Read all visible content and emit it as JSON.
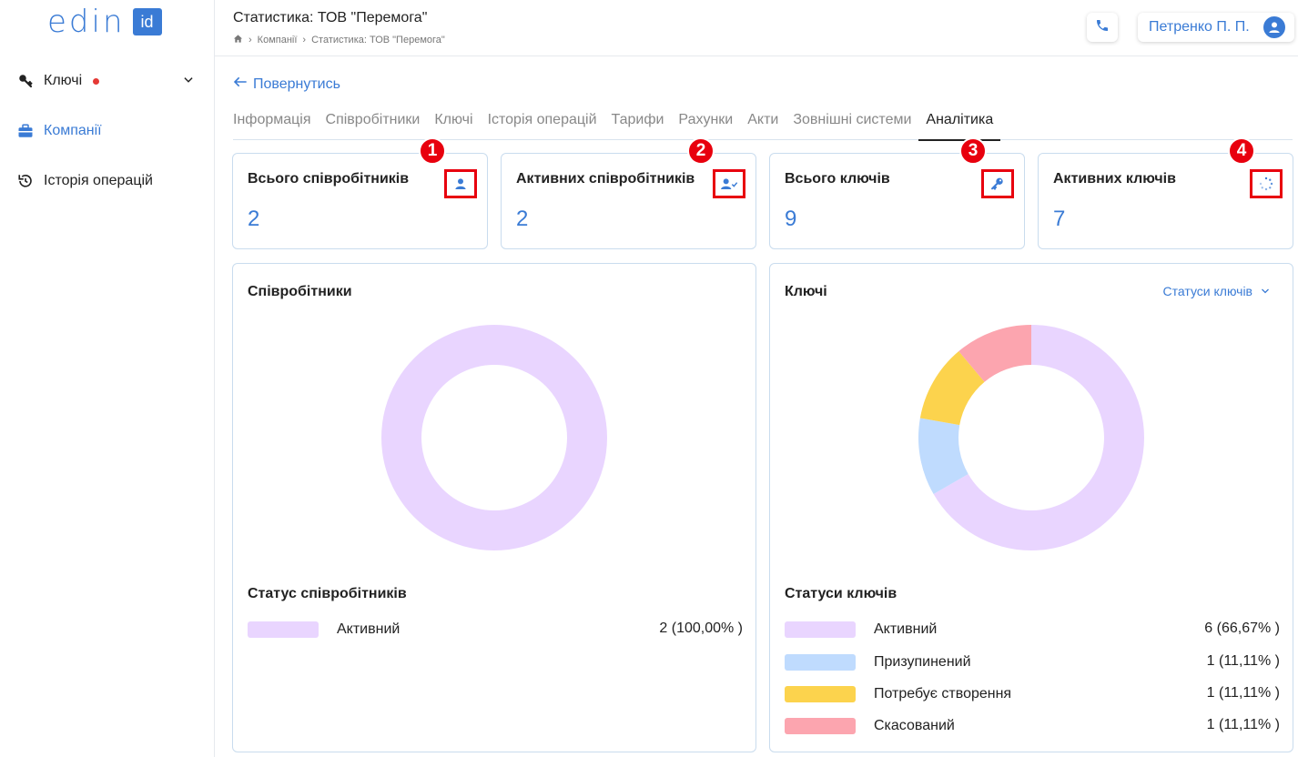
{
  "logo": {
    "text": "edin",
    "badge": "id"
  },
  "sidebar": {
    "items": [
      {
        "label": "Ключі"
      },
      {
        "label": "Компанії"
      },
      {
        "label": "Історія операцій"
      }
    ]
  },
  "header": {
    "title": "Статистика: ТОВ \"Перемога\"",
    "breadcrumb": [
      "Компанії",
      "Статистика: ТОВ \"Перемога\""
    ],
    "user": "Петренко П. П."
  },
  "back_label": "Повернутись",
  "tabs": [
    {
      "label": "Інформація"
    },
    {
      "label": "Співробітники"
    },
    {
      "label": "Ключі"
    },
    {
      "label": "Історія операцій"
    },
    {
      "label": "Тарифи"
    },
    {
      "label": "Рахунки"
    },
    {
      "label": "Акти"
    },
    {
      "label": "Зовнішні системи"
    },
    {
      "label": "Аналітика",
      "active": true
    }
  ],
  "cards": [
    {
      "title": "Всього співробітників",
      "value": "2",
      "marker": "1",
      "icon": "user-icon"
    },
    {
      "title": "Активних співробітників",
      "value": "2",
      "marker": "2",
      "icon": "user-check-icon"
    },
    {
      "title": "Всього ключів",
      "value": "9",
      "marker": "3",
      "icon": "key-icon"
    },
    {
      "title": "Активних ключів",
      "value": "7",
      "marker": "4",
      "icon": "loading-icon"
    }
  ],
  "employees_panel": {
    "title": "Співробітники",
    "legend_title": "Статус співробітників",
    "legend": [
      {
        "label": "Активний",
        "value": "2 (100,00% )",
        "color": "#e9d5ff"
      }
    ]
  },
  "keys_panel": {
    "title": "Ключі",
    "dropdown": "Статуси ключів",
    "legend_title": "Статуси ключів",
    "legend": [
      {
        "label": "Активний",
        "value": "6 (66,67% )",
        "color": "#e9d5ff"
      },
      {
        "label": "Призупинений",
        "value": "1 (11,11% )",
        "color": "#bfdbfe"
      },
      {
        "label": "Потребує створення",
        "value": "1 (11,11% )",
        "color": "#fcd34d"
      },
      {
        "label": "Скасований",
        "value": "1 (11,11% )",
        "color": "#fca5af"
      }
    ]
  },
  "chart_data": [
    {
      "type": "pie",
      "categories": [
        "Активний"
      ],
      "values": [
        2
      ]
    },
    {
      "type": "pie",
      "categories": [
        "Активний",
        "Призупинений",
        "Потребує створення",
        "Скасований"
      ],
      "values": [
        6,
        1,
        1,
        1
      ]
    }
  ],
  "colors": {
    "accent": "#3a7bd5",
    "marker": "#e8000e"
  }
}
